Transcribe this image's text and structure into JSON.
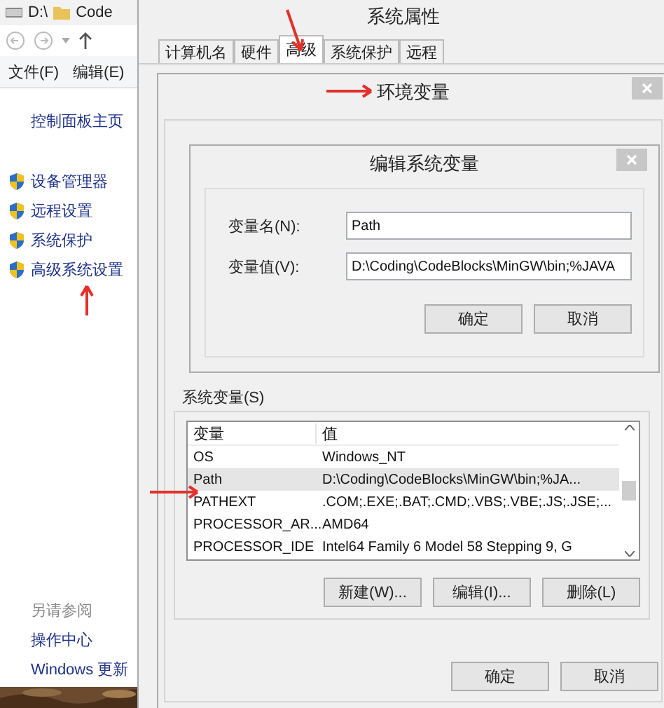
{
  "explorer": {
    "breadcrumb": [
      "D:\\",
      "Code"
    ],
    "menu": [
      "文件(F)",
      "编辑(E)"
    ],
    "sidebar_home": "控制面板主页",
    "sidebar_items": [
      "设备管理器",
      "远程设置",
      "系统保护",
      "高级系统设置"
    ],
    "see_also": {
      "heading": "另请参阅",
      "links": [
        "操作中心",
        "Windows 更新"
      ]
    }
  },
  "system_properties": {
    "title": "系统属性",
    "tabs": [
      {
        "label": "计算机名",
        "selected": false
      },
      {
        "label": "硬件",
        "selected": false
      },
      {
        "label": "高级",
        "selected": true
      },
      {
        "label": "系统保护",
        "selected": false
      },
      {
        "label": "远程",
        "selected": false
      }
    ]
  },
  "environment_variables": {
    "title": "环境变量",
    "system_variables": {
      "label": "系统变量(S)",
      "columns": [
        "变量",
        "值"
      ],
      "rows": [
        {
          "name": "OS",
          "value": "Windows_NT",
          "selected": false
        },
        {
          "name": "Path",
          "value": "D:\\Coding\\CodeBlocks\\MinGW\\bin;%JA...",
          "selected": true
        },
        {
          "name": "PATHEXT",
          "value": ".COM;.EXE;.BAT;.CMD;.VBS;.VBE;.JS;.JSE;...",
          "selected": false
        },
        {
          "name": "PROCESSOR_AR...",
          "value": "AMD64",
          "selected": false
        },
        {
          "name": "PROCESSOR_IDE",
          "value": "Intel64 Family 6 Model 58 Stepping 9, G",
          "selected": false
        }
      ]
    },
    "list_buttons": [
      "新建(W)...",
      "编辑(I)...",
      "删除(L)"
    ],
    "buttons": [
      "确定",
      "取消"
    ]
  },
  "edit_dialog": {
    "title": "编辑系统变量",
    "fields": [
      {
        "label": "变量名(N):",
        "value": "Path"
      },
      {
        "label": "变量值(V):",
        "value": "D:\\Coding\\CodeBlocks\\MinGW\\bin;%JAVA"
      }
    ],
    "buttons": [
      "确定",
      "取消"
    ]
  }
}
